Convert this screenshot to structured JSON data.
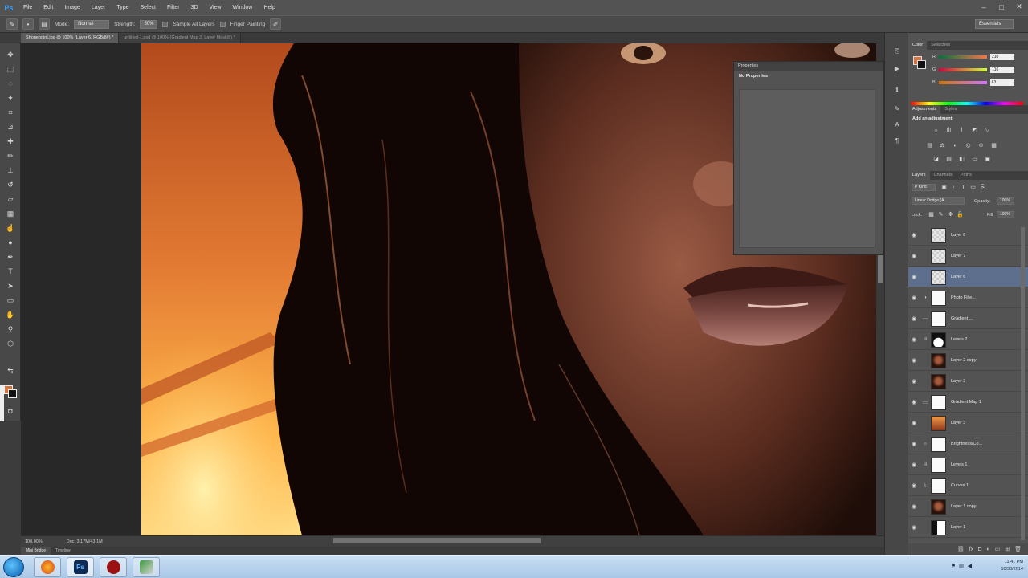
{
  "app": {
    "logo": "Ps"
  },
  "menu": [
    "File",
    "Edit",
    "Image",
    "Layer",
    "Type",
    "Select",
    "Filter",
    "3D",
    "View",
    "Window",
    "Help"
  ],
  "window_controls": {
    "minimize": "–",
    "maximize": "□",
    "close": "✕"
  },
  "options_bar": {
    "mode_label": "Mode:",
    "mode_value": "Normal",
    "strength_label": "Strength:",
    "strength_value": "50%",
    "sample_all_layers": "Sample All Layers",
    "finger_painting": "Finger Painting",
    "workspace": "Essentials"
  },
  "doc_tabs": [
    {
      "label": "Shonepoint.jpg @ 100% (Layer 6, RGB/8#) *",
      "active": true
    },
    {
      "label": "untitled-1.psd @ 100% (Gradient Map 2, Layer Mask/8) *",
      "active": false
    }
  ],
  "canvas_status": {
    "zoom": "100.00%",
    "doc": "Doc: 3.17M/43.1M"
  },
  "properties": {
    "title": "Properties",
    "message": "No Properties"
  },
  "color_panel": {
    "tabs": [
      "Color",
      "Swatches"
    ],
    "r": "210",
    "g": "116",
    "b": "63",
    "foreground": "#d2743f"
  },
  "adjustments_panel": {
    "tabs": [
      "Adjustments",
      "Styles"
    ],
    "title": "Add an adjustment"
  },
  "layers_panel": {
    "tabs": [
      "Layers",
      "Channels",
      "Paths"
    ],
    "kind": "P Kind",
    "blend": "Linear Dodge (A...",
    "opacity_label": "Opacity:",
    "opacity": "100%",
    "lock_label": "Lock:",
    "fill_label": "Fill:",
    "fill": "100%",
    "layers": [
      {
        "name": "Layer 8",
        "thumb": "t-check",
        "mark": "",
        "selected": false
      },
      {
        "name": "Layer 7",
        "thumb": "t-check",
        "mark": "",
        "selected": false
      },
      {
        "name": "Layer 6",
        "thumb": "t-check",
        "mark": "",
        "selected": true
      },
      {
        "name": "Photo Filte...",
        "thumb": "t-white",
        "mark": "◑",
        "selected": false
      },
      {
        "name": "Gradient ...",
        "thumb": "t-white",
        "mark": "▭",
        "selected": false
      },
      {
        "name": "Levels 2",
        "thumb": "t-mask2",
        "mark": "ılı",
        "selected": false
      },
      {
        "name": "Layer 2 copy",
        "thumb": "t-face",
        "mark": "",
        "selected": false
      },
      {
        "name": "Layer 2",
        "thumb": "t-face",
        "mark": "",
        "selected": false
      },
      {
        "name": "Gradient Map 1",
        "thumb": "t-white",
        "mark": "▭",
        "selected": false
      },
      {
        "name": "Layer 3",
        "thumb": "t-orange",
        "mark": "",
        "selected": false
      },
      {
        "name": "Brightness/Co...",
        "thumb": "t-white",
        "mark": "☼",
        "selected": false
      },
      {
        "name": "Levels 1",
        "thumb": "t-white",
        "mark": "ılı",
        "selected": false
      },
      {
        "name": "Curves 1",
        "thumb": "t-white",
        "mark": "⌇",
        "selected": false
      },
      {
        "name": "Layer 1 copy",
        "thumb": "t-face",
        "mark": "",
        "selected": false
      },
      {
        "name": "Layer 1",
        "thumb": "t-mask",
        "mark": "",
        "selected": false
      }
    ]
  },
  "mini_bridge": {
    "tabs": [
      "Mini Bridge",
      "Timeline"
    ]
  },
  "taskbar": {
    "apps": [
      "Firefox",
      "Ps",
      "Acrobat",
      "App"
    ],
    "time": "11:41 PM",
    "date": "10/30/2014"
  }
}
